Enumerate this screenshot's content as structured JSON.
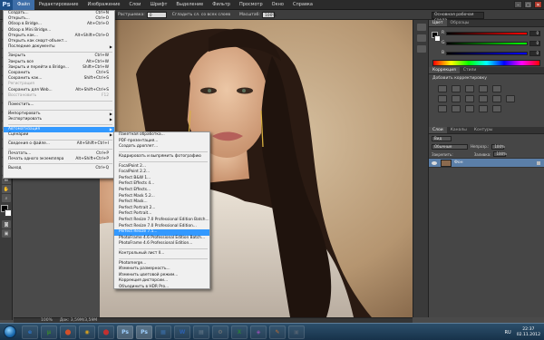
{
  "app": {
    "logo": "Ps"
  },
  "menubar": {
    "items": [
      "Файл",
      "Редактирование",
      "Изображение",
      "Слои",
      "Шрифт",
      "Выделение",
      "Фильтр",
      "Просмотр",
      "Окно",
      "Справка"
    ],
    "window_controls": [
      "–",
      "□",
      "✕"
    ]
  },
  "options_bar": {
    "style_label": "Растушевка:",
    "feather_value": "0 пикс.",
    "smooth_label": "Сгладить сл. со всех слоев",
    "zoom_label": "Масштаб:",
    "zoom_value": "100%",
    "workspace": "Основная рабочая среда"
  },
  "file_menu": {
    "items": [
      {
        "label": "Создать...",
        "shortcut": "Ctrl+N"
      },
      {
        "label": "Открыть...",
        "shortcut": "Ctrl+O"
      },
      {
        "label": "Обзор в Bridge...",
        "shortcut": "Alt+Ctrl+O"
      },
      {
        "label": "Обзор в Mini Bridge...",
        "shortcut": ""
      },
      {
        "label": "Открыть как...",
        "shortcut": "Alt+Shift+Ctrl+O"
      },
      {
        "label": "Открыть как смарт-объект...",
        "shortcut": ""
      },
      {
        "label": "Последние документы",
        "shortcut": "",
        "submenu": true
      },
      {
        "sep": true
      },
      {
        "label": "Закрыть",
        "shortcut": "Ctrl+W"
      },
      {
        "label": "Закрыть все",
        "shortcut": "Alt+Ctrl+W"
      },
      {
        "label": "Закрыть и перейти в Bridge...",
        "shortcut": "Shift+Ctrl+W"
      },
      {
        "label": "Сохранить",
        "shortcut": "Ctrl+S"
      },
      {
        "label": "Сохранить как...",
        "shortcut": "Shift+Ctrl+S"
      },
      {
        "label": "Регистрация",
        "shortcut": "",
        "disabled": true
      },
      {
        "label": "Сохранить для Web...",
        "shortcut": "Alt+Shift+Ctrl+S"
      },
      {
        "label": "Восстановить",
        "shortcut": "F12",
        "disabled": true
      },
      {
        "sep": true
      },
      {
        "label": "Поместить...",
        "shortcut": ""
      },
      {
        "sep": true
      },
      {
        "label": "Импортировать",
        "shortcut": "",
        "submenu": true
      },
      {
        "label": "Экспортировать",
        "shortcut": "",
        "submenu": true
      },
      {
        "sep": true
      },
      {
        "label": "Автоматизация",
        "shortcut": "",
        "submenu": true,
        "highlighted": true
      },
      {
        "label": "Сценарии",
        "shortcut": "",
        "submenu": true
      },
      {
        "sep": true
      },
      {
        "label": "Сведения о файле...",
        "shortcut": "Alt+Shift+Ctrl+I"
      },
      {
        "sep": true
      },
      {
        "label": "Печатать...",
        "shortcut": "Ctrl+P"
      },
      {
        "label": "Печать одного экземпляра",
        "shortcut": "Alt+Shift+Ctrl+P"
      },
      {
        "sep": true
      },
      {
        "label": "Выход",
        "shortcut": "Ctrl+Q"
      }
    ]
  },
  "automation_menu": {
    "items": [
      {
        "label": "Пакетная обработка..."
      },
      {
        "label": "PDF-презентация..."
      },
      {
        "label": "Создать дроплет..."
      },
      {
        "sep": true
      },
      {
        "label": "Кадрировать и выпрямить фотографию"
      },
      {
        "sep": true
      },
      {
        "label": "FocalPoint 2..."
      },
      {
        "label": "FocalPoint 2.2..."
      },
      {
        "label": "Perfect B&W 1..."
      },
      {
        "label": "Perfect Effects 4..."
      },
      {
        "label": "Perfect Effects..."
      },
      {
        "label": "Perfect Mask 5.2..."
      },
      {
        "label": "Perfect Mask..."
      },
      {
        "label": "Perfect Portrait 2..."
      },
      {
        "label": "Perfect Portrait..."
      },
      {
        "label": "Perfect Resize 7.0 Professional Edition Batch..."
      },
      {
        "label": "Perfect Resize 7.0 Professional Edition..."
      },
      {
        "label": "Perfect Resize 7.5...",
        "highlighted": true
      },
      {
        "label": "PhotoFrame 4.6 Professional Edition Batch..."
      },
      {
        "label": "PhotoFrame 4.6 Professional Edition..."
      },
      {
        "sep": true
      },
      {
        "label": "Контрольный лист II..."
      },
      {
        "sep": true
      },
      {
        "label": "Photomerge..."
      },
      {
        "label": "Изменить размерность..."
      },
      {
        "label": "Изменить цветовой режим..."
      },
      {
        "label": "Коррекция дисторсии..."
      },
      {
        "label": "Объединить в HDR Pro..."
      }
    ]
  },
  "status_bar": {
    "zoom": "100%",
    "doc": "Док: 3,59M/3,59M"
  },
  "color_panel": {
    "tabs": [
      "Цвет",
      "Образцы"
    ],
    "rows": [
      {
        "label": "R",
        "value": "0",
        "gradient": "linear-gradient(to right, #000, #f00)"
      },
      {
        "label": "G",
        "value": "0",
        "gradient": "linear-gradient(to right, #000, #0f0)"
      },
      {
        "label": "B",
        "value": "0",
        "gradient": "linear-gradient(to right, #000, #00f)"
      }
    ]
  },
  "adjustments_panel": {
    "tabs": [
      "Коррекция",
      "Стили"
    ],
    "subtitle": "Добавить корректировку"
  },
  "layers_panel": {
    "tabs": [
      "Слои",
      "Каналы",
      "Контуры"
    ],
    "kind_label": "Вид",
    "blend_mode": "Обычные",
    "opacity_label": "Непрозр.:",
    "opacity_value": "100%",
    "lock_label": "Закрепить:",
    "fill_label": "Заливка:",
    "fill_value": "100%",
    "layer_name": "Фон"
  },
  "taskbar": {
    "apps": [
      "e",
      "μ",
      "⬤",
      "◉",
      "⬤",
      "Ps",
      "Ps",
      "▦",
      "W",
      "▤",
      "⚙",
      "X",
      "◈",
      "✎",
      "▣"
    ],
    "lang": "RU",
    "time": "22:37",
    "date": "02.11.2012"
  }
}
